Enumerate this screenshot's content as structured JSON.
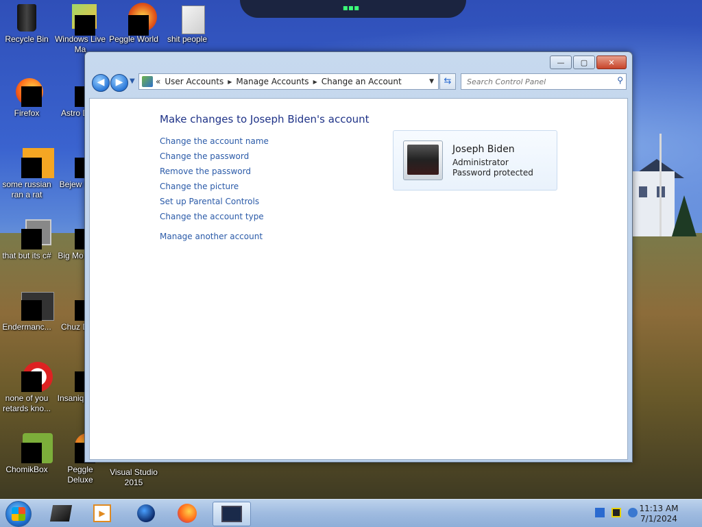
{
  "desktop": {
    "icons": [
      {
        "label": "Recycle Bin"
      },
      {
        "label": "Windows Live Ma"
      },
      {
        "label": "Peggle World"
      },
      {
        "label": "shit people"
      },
      {
        "label": "Firefox"
      },
      {
        "label": "Astro Delu"
      },
      {
        "label": "some russian ran a rat"
      },
      {
        "label": "Bejew Delu"
      },
      {
        "label": "that but its c#"
      },
      {
        "label": "Big Mo Delu"
      },
      {
        "label": "Endermanc..."
      },
      {
        "label": "Chuz Delu"
      },
      {
        "label": "none of you retards kno..."
      },
      {
        "label": "Insaniq Delu"
      },
      {
        "label": "ChomikBox"
      },
      {
        "label": "Peggle Deluxe"
      },
      {
        "label": "Visual Studio 2015"
      }
    ]
  },
  "window": {
    "controls": {
      "minimize": "—",
      "maximize": "▢",
      "close": "✕"
    },
    "nav": {
      "back": "◀",
      "forward": "▶",
      "recent": "▼"
    },
    "breadcrumb": {
      "prefix": "«",
      "items": [
        "User Accounts",
        "Manage Accounts",
        "Change an Account"
      ]
    },
    "search_placeholder": "Search Control Panel",
    "page_title": "Make changes to Joseph Biden's account",
    "links": [
      "Change the account name",
      "Change the password",
      "Remove the password",
      "Change the picture",
      "Set up Parental Controls",
      "Change the account type"
    ],
    "manage_another": "Manage another account",
    "account": {
      "name": "Joseph Biden",
      "role": "Administrator",
      "status": "Password protected"
    }
  },
  "taskbar": {
    "clock_time": "11:13 AM",
    "clock_date": "7/1/2024"
  }
}
